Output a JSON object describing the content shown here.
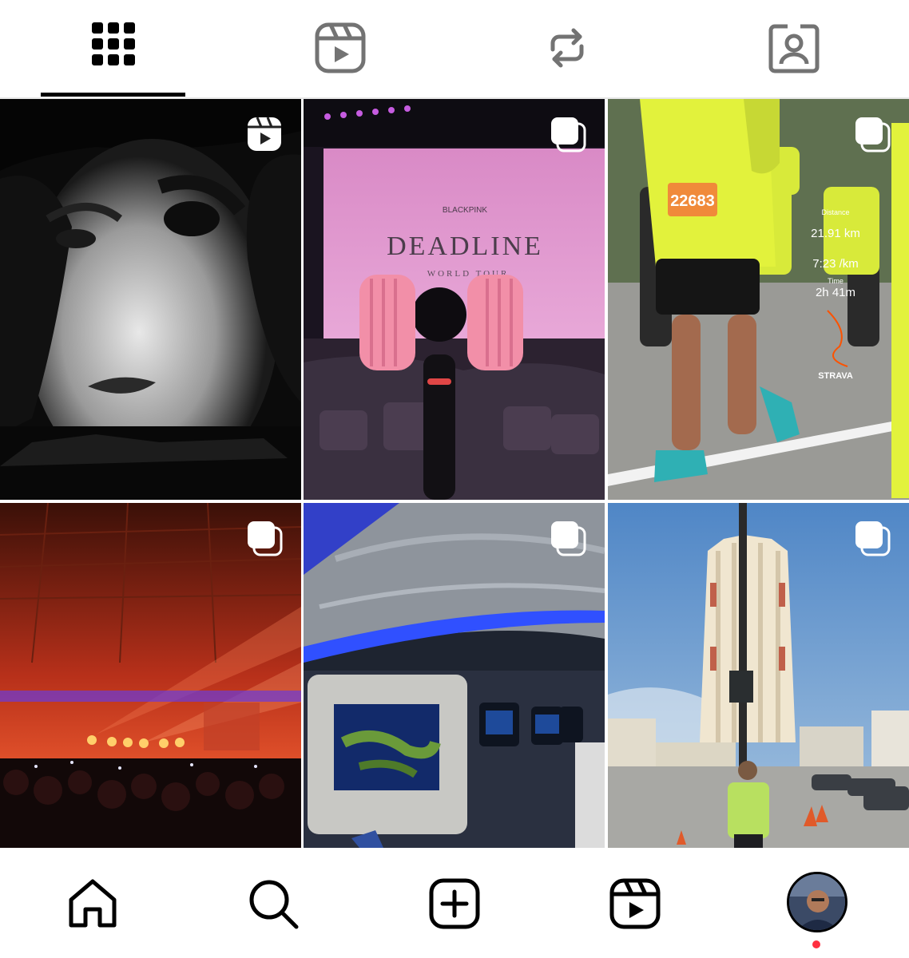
{
  "profile_tabs": [
    {
      "name": "posts-grid",
      "icon": "grid-icon",
      "active": true
    },
    {
      "name": "reels",
      "icon": "reels-icon",
      "active": false
    },
    {
      "name": "reposts",
      "icon": "repost-icon",
      "active": false
    },
    {
      "name": "tagged",
      "icon": "tagged-person-icon",
      "active": false
    }
  ],
  "posts": [
    {
      "id": "post-1",
      "kind": "reel",
      "badge_icon": "reels-badge-icon"
    },
    {
      "id": "post-2",
      "kind": "carousel",
      "badge_icon": "carousel-icon",
      "text": {
        "brand": "BLACKPINK",
        "title": "DEADLINE",
        "subtitle": "WORLD TOUR"
      }
    },
    {
      "id": "post-3",
      "kind": "carousel",
      "badge_icon": "carousel-icon",
      "text": {
        "bib": "22683",
        "distance_label": "Distance",
        "distance": "21.91 km",
        "pace": "7:23 /km",
        "time_label": "Time",
        "time": "2h 41m",
        "app": "STRAVA"
      }
    },
    {
      "id": "post-4",
      "kind": "carousel",
      "badge_icon": "carousel-icon"
    },
    {
      "id": "post-5",
      "kind": "carousel",
      "badge_icon": "carousel-icon"
    },
    {
      "id": "post-6",
      "kind": "carousel",
      "badge_icon": "carousel-icon"
    }
  ],
  "bottom_nav": [
    {
      "name": "home",
      "icon": "home-icon"
    },
    {
      "name": "search",
      "icon": "search-icon"
    },
    {
      "name": "create",
      "icon": "create-plus-icon"
    },
    {
      "name": "reels",
      "icon": "reels-icon"
    },
    {
      "name": "profile",
      "icon": "profile-avatar",
      "notification_dot": true
    }
  ],
  "colors": {
    "notification_dot": "#ff3040",
    "active_underline": "#000000",
    "tab_icon_inactive": "#737373"
  }
}
